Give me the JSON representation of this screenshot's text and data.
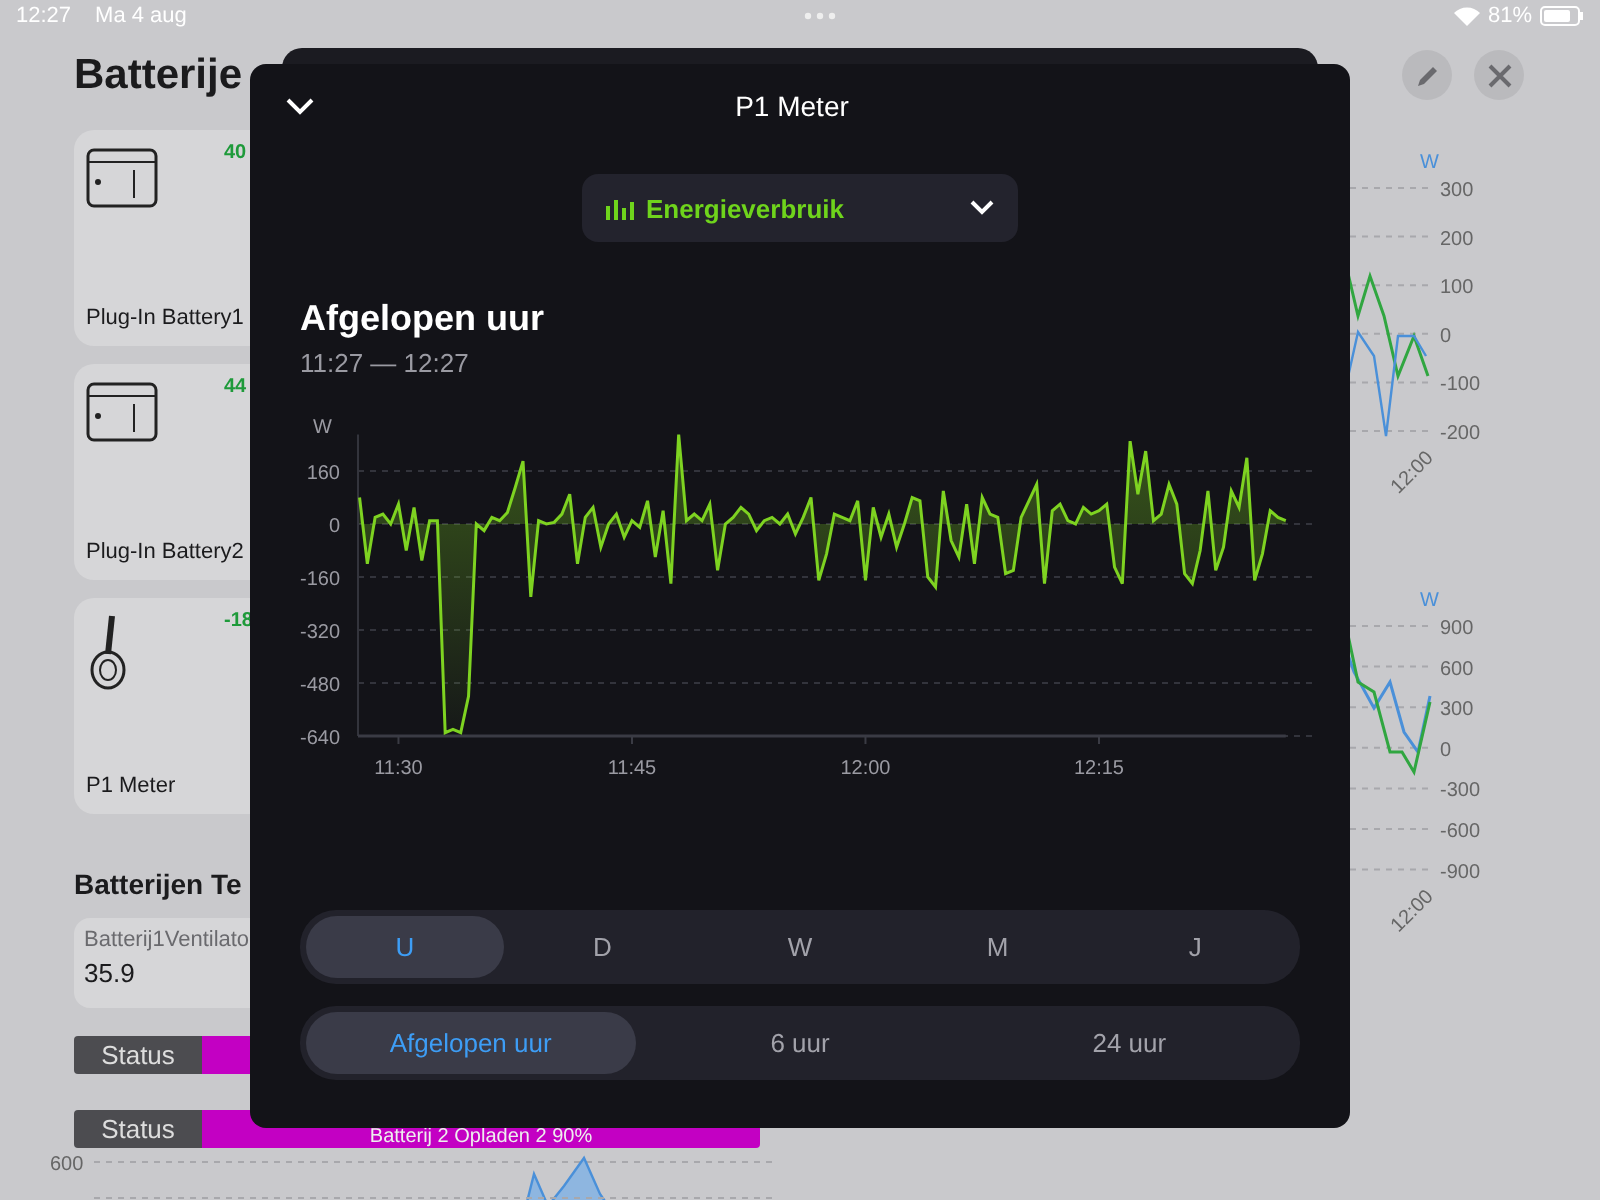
{
  "status_bar": {
    "time": "12:27",
    "date": "Ma 4 aug",
    "battery": "81%"
  },
  "page": {
    "title": "Batterije",
    "devices": [
      {
        "kind": "battery",
        "name": "Plug-In Battery1",
        "power": "40"
      },
      {
        "kind": "battery",
        "name": "Plug-In Battery2",
        "power": "44"
      },
      {
        "kind": "meter",
        "name": "P1 Meter",
        "power": "-18"
      }
    ],
    "section_title": "Batterijen Te",
    "sensor": {
      "label": "Batterij1Ventilato",
      "value": "35.9"
    },
    "status_rows": [
      {
        "label": "Status",
        "text": ""
      },
      {
        "label": "Status",
        "text": "Batterij 2 Opladen 2 90%"
      }
    ],
    "background_charts": [
      {
        "unit": "W",
        "yticks": [
          "300",
          "200",
          "100",
          "0",
          "-100",
          "-200"
        ],
        "xlabel": "12:00"
      },
      {
        "unit": "W",
        "yticks": [
          "900",
          "600",
          "300",
          "0",
          "-300",
          "-600",
          "-900"
        ],
        "xlabel": "12:00"
      },
      {
        "yticks": [
          "600"
        ]
      }
    ]
  },
  "sheet": {
    "title": "P1 Meter",
    "dropdown": "Energieverbruik",
    "heading": "Afgelopen uur",
    "range": "11:27 — 12:27",
    "chart_data": {
      "type": "area",
      "ylabel": "W",
      "ylim": [
        -640,
        270
      ],
      "grid": true,
      "yticks": [
        160,
        0,
        -160,
        -320,
        -480,
        -640
      ],
      "categories": [
        null,
        null,
        null,
        null,
        null,
        "11:30",
        null,
        null,
        null,
        null,
        null,
        null,
        null,
        null,
        null,
        null,
        null,
        null,
        null,
        null,
        null,
        null,
        null,
        null,
        null,
        null,
        null,
        null,
        null,
        null,
        null,
        null,
        null,
        null,
        null,
        "11:45",
        null,
        null,
        null,
        null,
        null,
        null,
        null,
        null,
        null,
        null,
        null,
        null,
        null,
        null,
        null,
        null,
        null,
        null,
        null,
        null,
        null,
        null,
        null,
        null,
        null,
        null,
        null,
        null,
        null,
        "12:00",
        null,
        null,
        null,
        null,
        null,
        null,
        null,
        null,
        null,
        null,
        null,
        null,
        null,
        null,
        null,
        null,
        null,
        null,
        null,
        null,
        null,
        null,
        null,
        null,
        null,
        null,
        null,
        null,
        null,
        "12:15",
        null,
        null,
        null,
        null,
        null,
        null,
        null,
        null,
        null,
        null,
        null,
        null,
        null,
        null,
        null,
        null,
        null,
        null,
        null,
        null,
        null,
        null,
        null,
        null
      ],
      "series": [
        {
          "color": "#7ed321",
          "values": [
            80,
            -120,
            20,
            30,
            0,
            60,
            -80,
            50,
            -110,
            10,
            10,
            -630,
            -620,
            -630,
            -520,
            0,
            -20,
            20,
            10,
            35,
            110,
            190,
            -220,
            10,
            0,
            5,
            30,
            90,
            -120,
            20,
            50,
            -70,
            0,
            30,
            -40,
            10,
            -10,
            70,
            -100,
            40,
            -180,
            270,
            10,
            30,
            10,
            60,
            -140,
            0,
            20,
            50,
            30,
            -20,
            10,
            20,
            0,
            30,
            -30,
            20,
            80,
            -170,
            -90,
            30,
            20,
            10,
            70,
            -170,
            50,
            -40,
            30,
            -70,
            0,
            80,
            70,
            -160,
            -190,
            100,
            -50,
            -100,
            60,
            -120,
            80,
            30,
            20,
            -150,
            -140,
            20,
            70,
            120,
            -180,
            40,
            60,
            10,
            0,
            50,
            30,
            40,
            60,
            -130,
            -180,
            250,
            90,
            220,
            10,
            30,
            120,
            60,
            -150,
            -180,
            -80,
            100,
            -140,
            -70,
            100,
            50,
            200,
            -170,
            -90,
            40,
            20,
            10
          ]
        }
      ]
    },
    "periods": [
      {
        "label": "U",
        "selected": true
      },
      {
        "label": "D",
        "selected": false
      },
      {
        "label": "W",
        "selected": false
      },
      {
        "label": "M",
        "selected": false
      },
      {
        "label": "J",
        "selected": false
      }
    ],
    "ranges": [
      {
        "label": "Afgelopen uur",
        "selected": true
      },
      {
        "label": "6 uur",
        "selected": false
      },
      {
        "label": "24 uur",
        "selected": false
      }
    ]
  }
}
